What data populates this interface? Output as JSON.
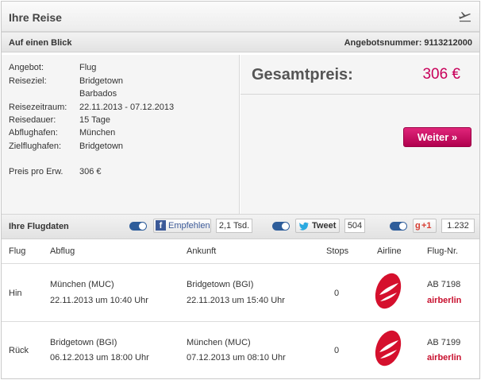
{
  "header": {
    "title": "Ihre Reise",
    "icon": "plane-icon"
  },
  "summary_bar": {
    "label": "Auf einen Blick",
    "offer_number": "Angebotsnummer: 9113212000"
  },
  "details": {
    "offer_label": "Angebot:",
    "offer_value": "Flug",
    "dest_label": "Reiseziel:",
    "dest_value_1": "Bridgetown",
    "dest_value_2": "Barbados",
    "period_label": "Reisezeitraum:",
    "period_value": "22.11.2013 - 07.12.2013",
    "duration_label": "Reisedauer:",
    "duration_value": "15 Tage",
    "depart_airport_label": "Abflughafen:",
    "depart_airport_value": "München",
    "dest_airport_label": "Zielflughafen:",
    "dest_airport_value": "Bridgetown",
    "price_per_label": "Preis pro Erw.",
    "price_per_value": "306 €"
  },
  "total": {
    "label": "Gesamtpreis:",
    "value": "306 €",
    "button": "Weiter »",
    "accent": "#c8005a"
  },
  "flight_bar": {
    "label": "Ihre Flugdaten"
  },
  "social": {
    "facebook_label": "Empfehlen",
    "facebook_count": "2,1 Tsd.",
    "twitter_label": "Tweet",
    "twitter_count": "504",
    "google_label": "+1",
    "google_count": "1.232"
  },
  "table": {
    "headers": {
      "flug": "Flug",
      "abflug": "Abflug",
      "ankunft": "Ankunft",
      "stops": "Stops",
      "airline": "Airline",
      "flugnr": "Flug-Nr."
    },
    "rows": [
      {
        "flug": "Hin",
        "dep_place": "München (MUC)",
        "dep_time": "22.11.2013 um 10:40 Uhr",
        "arr_place": "Bridgetown (BGI)",
        "arr_time": "22.11.2013 um 15:40 Uhr",
        "stops": "0",
        "flight_no": "AB 7198",
        "airline": "airberlin"
      },
      {
        "flug": "Rück",
        "dep_place": "Bridgetown (BGI)",
        "dep_time": "06.12.2013 um 18:00 Uhr",
        "arr_place": "München (MUC)",
        "arr_time": "07.12.2013 um 08:10 Uhr",
        "stops": "0",
        "flight_no": "AB 7199",
        "airline": "airberlin"
      }
    ]
  }
}
